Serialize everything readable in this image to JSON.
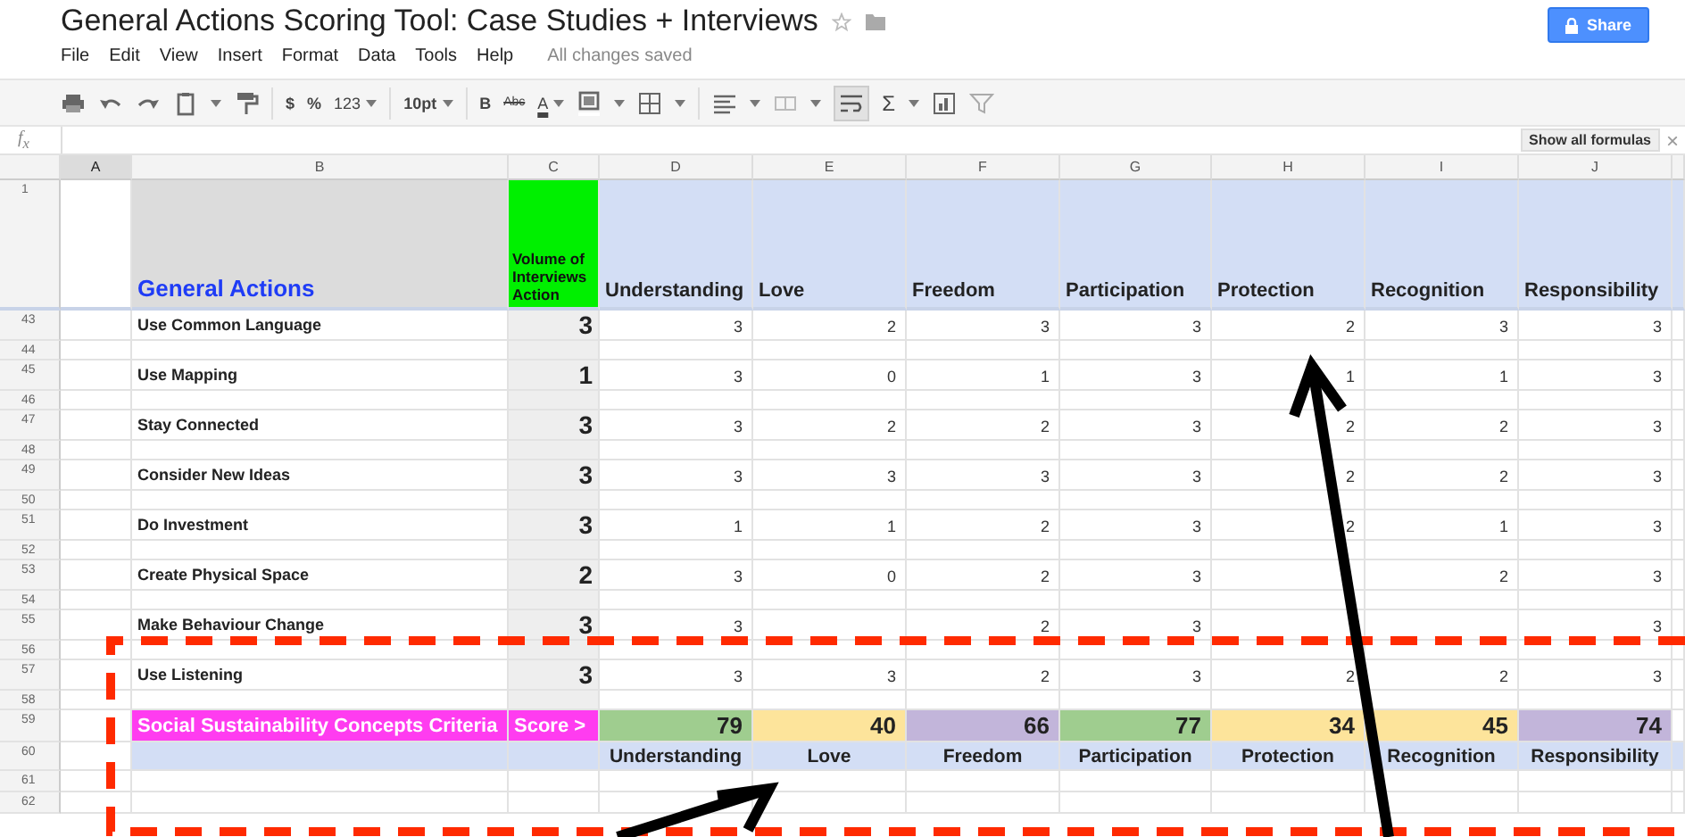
{
  "document": {
    "title": "General Actions Scoring Tool: Case Studies + Interviews",
    "starred": false,
    "status": "All changes saved"
  },
  "menu": [
    "File",
    "Edit",
    "View",
    "Insert",
    "Format",
    "Data",
    "Tools",
    "Help"
  ],
  "share_button": "Share",
  "toolbar": [
    "$",
    "%",
    "123",
    "10pt",
    "B",
    "Abc",
    "A",
    "Σ"
  ],
  "formula_bar": {
    "label": "f$_{x}$",
    "button": "Show all formulas",
    "close": "×"
  },
  "column_headers": [
    {
      "label": "A",
      "selected": true
    },
    {
      "label": "B",
      "selected": false
    },
    {
      "label": "C",
      "selected": false
    },
    {
      "label": "D",
      "selected": false
    },
    {
      "label": "E",
      "selected": false
    },
    {
      "label": "F",
      "selected": false
    },
    {
      "label": "G",
      "selected": false
    },
    {
      "label": "H",
      "selected": false
    },
    {
      "label": "I",
      "selected": false
    },
    {
      "label": "J",
      "selected": false
    }
  ],
  "header_row": {
    "number": "1",
    "title": "General Actions",
    "volume": "Volume of Interviews Action",
    "concepts": [
      "Understanding",
      "Love",
      "Freedom",
      "Participation",
      "Protection",
      "Recognition",
      "Responsibility"
    ]
  },
  "rows": [
    {
      "kind": "data",
      "number": "43",
      "action": "Use Common Language",
      "volume": "3",
      "scores": {
        "D": "3",
        "E": "2",
        "F": "3",
        "G": "3",
        "H": "2",
        "I": "3",
        "J": "3"
      }
    },
    {
      "kind": "spacer",
      "number": "44"
    },
    {
      "kind": "data",
      "number": "45",
      "action": "Use Mapping",
      "volume": "1",
      "scores": {
        "D": "3",
        "E": "0",
        "F": "1",
        "G": "3",
        "H": "1",
        "I": "1",
        "J": "3"
      }
    },
    {
      "kind": "spacer",
      "number": "46"
    },
    {
      "kind": "data",
      "number": "47",
      "action": "Stay Connected",
      "volume": "3",
      "scores": {
        "D": "3",
        "E": "2",
        "F": "2",
        "G": "3",
        "H": "2",
        "I": "2",
        "J": "3"
      }
    },
    {
      "kind": "spacer",
      "number": "48"
    },
    {
      "kind": "data",
      "number": "49",
      "action": "Consider New Ideas",
      "volume": "3",
      "scores": {
        "D": "3",
        "E": "3",
        "F": "3",
        "G": "3",
        "H": "2",
        "I": "2",
        "J": "3"
      }
    },
    {
      "kind": "spacer",
      "number": "50"
    },
    {
      "kind": "data",
      "number": "51",
      "action": "Do Investment",
      "volume": "3",
      "scores": {
        "D": "1",
        "E": "1",
        "F": "2",
        "G": "3",
        "H": "2",
        "I": "1",
        "J": "3"
      }
    },
    {
      "kind": "spacer",
      "number": "52"
    },
    {
      "kind": "data",
      "number": "53",
      "action": "Create Physical Space",
      "volume": "2",
      "scores": {
        "D": "3",
        "E": "0",
        "F": "2",
        "G": "3",
        "I": "2",
        "J": "3"
      }
    },
    {
      "kind": "spacer",
      "number": "54"
    },
    {
      "kind": "data",
      "number": "55",
      "action": "Make Behaviour Change",
      "volume": "3",
      "scores": {
        "D": "3",
        "F": "2",
        "G": "3",
        "J": "3"
      }
    },
    {
      "kind": "spacer",
      "number": "56"
    },
    {
      "kind": "data",
      "number": "57",
      "action": "Use Listening",
      "volume": "3",
      "scores": {
        "D": "3",
        "E": "3",
        "F": "2",
        "G": "3",
        "H": "2",
        "I": "2",
        "J": "3"
      }
    },
    {
      "kind": "spacer",
      "number": "58"
    }
  ],
  "score_row": {
    "number": "59",
    "label": "Social Sustainability Concepts Criteria",
    "marker": "Score >",
    "scores": [
      {
        "value": "79",
        "color": "#9fcd8f"
      },
      {
        "value": "40",
        "color": "#fde49b"
      },
      {
        "value": "66",
        "color": "#c2b5da"
      },
      {
        "value": "77",
        "color": "#9fcd8f"
      },
      {
        "value": "34",
        "color": "#fde49b"
      },
      {
        "value": "45",
        "color": "#fde49b"
      },
      {
        "value": "74",
        "color": "#c2b5da"
      }
    ]
  },
  "concept_row": {
    "number": "60",
    "labels": [
      "Understanding",
      "Love",
      "Freedom",
      "Participation",
      "Protection",
      "Recognition",
      "Responsibility"
    ]
  },
  "empty_rows": [
    "61",
    "62"
  ]
}
